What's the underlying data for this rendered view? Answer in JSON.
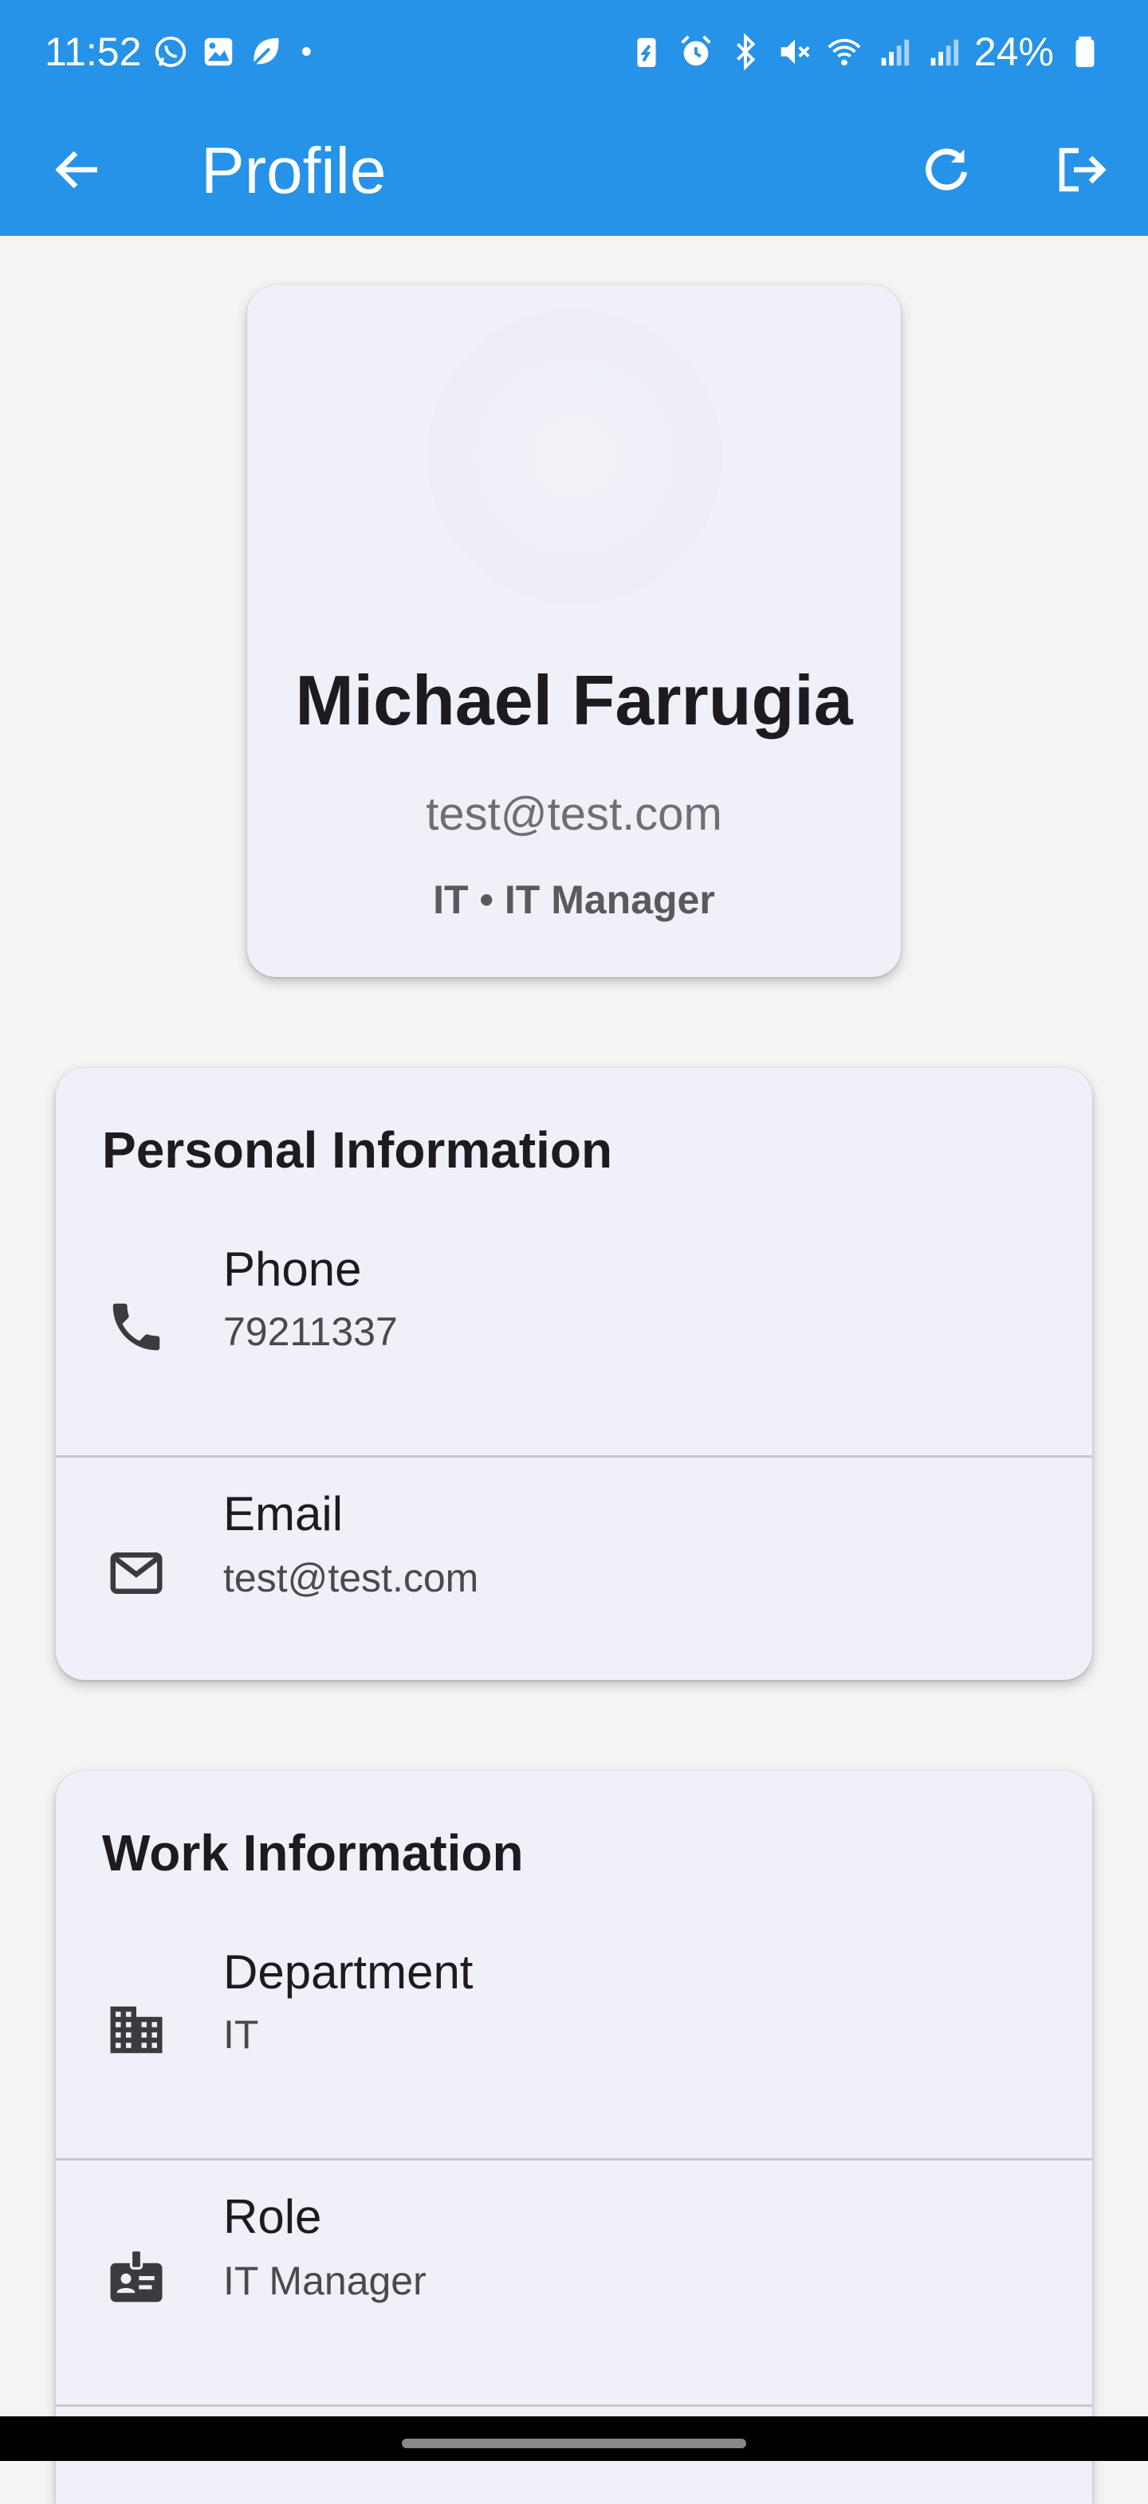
{
  "status_bar": {
    "time": "11:52",
    "battery": "24%",
    "icons_left": [
      "whatsapp-icon",
      "gallery-icon",
      "leaf-icon",
      "dot-icon"
    ],
    "icons_right": [
      "battery-saver-icon",
      "alarm-icon",
      "bluetooth-icon",
      "mute-icon",
      "wifi-icon",
      "signal-icon",
      "signal-icon",
      "battery-icon"
    ]
  },
  "app_bar": {
    "title": "Profile",
    "background_color": "#2692e8",
    "actions": [
      "back-icon",
      "refresh-icon",
      "logout-icon"
    ]
  },
  "profile": {
    "name": "Michael Farrugia",
    "email": "test@test.com",
    "subtitle": "IT • IT Manager"
  },
  "personal_information": {
    "title": "Personal Information",
    "rows": [
      {
        "label": "Phone",
        "value": "79211337",
        "icon": "phone-icon"
      },
      {
        "label": "Email",
        "value": "test@test.com",
        "icon": "mail-icon"
      }
    ]
  },
  "work_information": {
    "title": "Work Information",
    "rows": [
      {
        "label": "Department",
        "value": "IT",
        "icon": "building-icon"
      },
      {
        "label": "Role",
        "value": "IT Manager",
        "icon": "badge-icon"
      }
    ]
  }
}
